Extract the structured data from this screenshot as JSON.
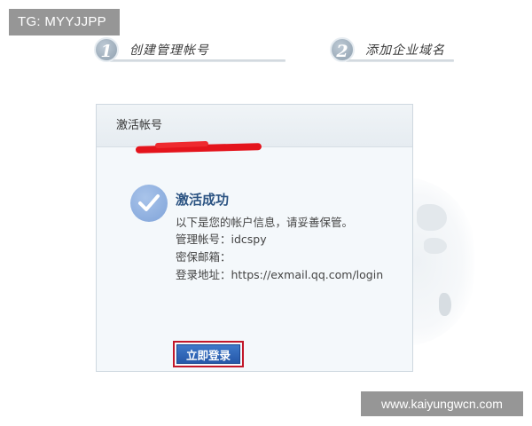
{
  "watermark": {
    "top": "TG: MYYJJPP",
    "bottom": "www.kaiyungwcn.com"
  },
  "steps": [
    {
      "number": "1",
      "label": "创建管理帐号"
    },
    {
      "number": "2",
      "label": "添加企业域名"
    }
  ],
  "card": {
    "header_title": "激活帐号",
    "success_title": "激活成功",
    "intro": "以下是您的帐户信息，请妥善保管。",
    "admin_account": "管理帐号：idcspy",
    "security_email": "密保邮箱：",
    "login_address": "登录地址：https://exmail.qq.com/login",
    "login_button": "立即登录"
  },
  "colors": {
    "accent": "#2558a9",
    "title": "#2b5382",
    "highlight_border": "#c2182a",
    "redaction": "#e4141c"
  },
  "icons": {
    "success": "check-circle-icon"
  }
}
